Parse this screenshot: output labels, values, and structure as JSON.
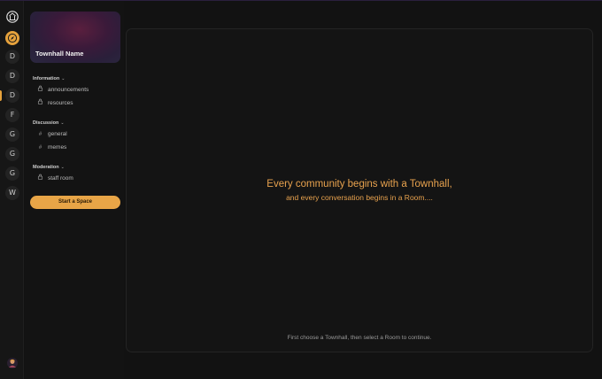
{
  "rail": {
    "servers": [
      "D",
      "D",
      "D",
      "F",
      "G",
      "G",
      "G",
      "W"
    ]
  },
  "sidebar": {
    "townhall_name": "Townhall Name",
    "sections": [
      {
        "title": "Information",
        "channels": [
          {
            "name": "announcements",
            "icon": "lock-icon"
          },
          {
            "name": "resources",
            "icon": "lock-icon"
          }
        ]
      },
      {
        "title": "Discussion",
        "channels": [
          {
            "name": "general",
            "icon": "hash-icon"
          },
          {
            "name": "memes",
            "icon": "hash-icon"
          }
        ]
      },
      {
        "title": "Moderation",
        "channels": [
          {
            "name": "staff room",
            "icon": "lock-icon"
          }
        ]
      }
    ],
    "start_button": "Start a Space"
  },
  "main": {
    "headline": "Every community begins with a Townhall,",
    "subline": "and every conversation begins in a Room....",
    "hint": "First choose a Townhall, then select a Room to continue."
  },
  "colors": {
    "accent": "#e8a547",
    "background": "#121212"
  }
}
